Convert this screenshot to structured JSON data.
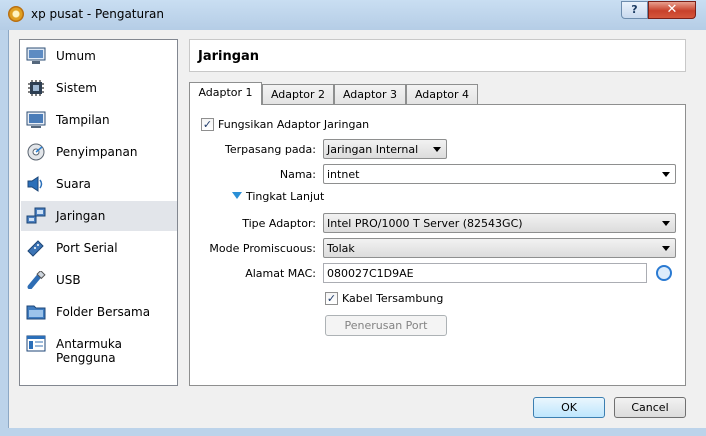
{
  "window": {
    "title": "xp pusat - Pengaturan",
    "help_glyph": "?",
    "close_glyph": "✕"
  },
  "sidebar": {
    "items": [
      {
        "label": "Umum",
        "icon": "monitor-icon"
      },
      {
        "label": "Sistem",
        "icon": "chip-icon"
      },
      {
        "label": "Tampilan",
        "icon": "display-icon"
      },
      {
        "label": "Penyimpanan",
        "icon": "disk-icon"
      },
      {
        "label": "Suara",
        "icon": "speaker-icon"
      },
      {
        "label": "Jaringan",
        "icon": "network-icon"
      },
      {
        "label": "Port Serial",
        "icon": "serial-port-icon"
      },
      {
        "label": "USB",
        "icon": "usb-icon"
      },
      {
        "label": "Folder Bersama",
        "icon": "folder-icon"
      },
      {
        "label": "Antarmuka Pengguna",
        "icon": "ui-window-icon"
      }
    ],
    "active": "Jaringan"
  },
  "panel": {
    "title": "Jaringan",
    "tabs": [
      "Adaptor 1",
      "Adaptor 2",
      "Adaptor 3",
      "Adaptor 4"
    ],
    "active_tab": "Adaptor 1",
    "enable_adapter": {
      "label": "Fungsikan Adaptor Jaringan",
      "checked": true
    },
    "attached_to": {
      "label": "Terpasang pada:",
      "value": "Jaringan Internal"
    },
    "name": {
      "label": "Nama:",
      "value": "intnet"
    },
    "advanced": {
      "label": "Tingkat Lanjut",
      "expanded": true
    },
    "adapter_type": {
      "label": "Tipe Adaptor:",
      "value": "Intel PRO/1000 T Server (82543GC)"
    },
    "promiscuous": {
      "label": "Mode Promiscuous:",
      "value": "Tolak"
    },
    "mac": {
      "label": "Alamat MAC:",
      "value": "080027C1D9AE"
    },
    "cable": {
      "label": "Kabel Tersambung",
      "checked": true
    },
    "port_forward": {
      "label": "Penerusan Port",
      "enabled": false
    },
    "check_mark": "✓"
  },
  "buttons": {
    "ok": "OK",
    "cancel": "Cancel"
  },
  "colors": {
    "accent": "#2a8fd6",
    "selection": "#e2e5ea",
    "close_red": "#c8412b"
  }
}
